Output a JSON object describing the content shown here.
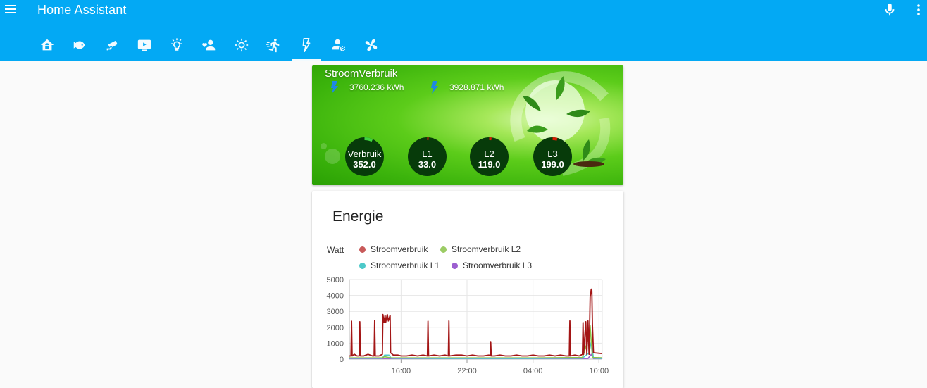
{
  "app": {
    "title": "Home Assistant"
  },
  "tabs": [
    {
      "icon": "home-icon",
      "active": false
    },
    {
      "icon": "fish-icon",
      "active": false
    },
    {
      "icon": "cctv-icon",
      "active": false
    },
    {
      "icon": "television-icon",
      "active": false
    },
    {
      "icon": "lightbulb-icon",
      "active": false
    },
    {
      "icon": "account-heart-icon",
      "active": false
    },
    {
      "icon": "weather-sunny-icon",
      "active": false
    },
    {
      "icon": "run-icon",
      "active": false
    },
    {
      "icon": "flash-icon",
      "active": true
    },
    {
      "icon": "account-settings-icon",
      "active": false
    },
    {
      "icon": "fan-icon",
      "active": false
    }
  ],
  "stroom": {
    "title": "StroomVerbruik",
    "meters": [
      {
        "icon": "flash-icon",
        "value": "3760.236 kWh"
      },
      {
        "icon": "flash-icon",
        "value": "3928.871 kWh"
      }
    ],
    "gauges": [
      {
        "label": "Verbruik",
        "value": "352.0",
        "fraction": 0.07
      },
      {
        "label": "L1",
        "value": "33.0",
        "fraction": 0.01
      },
      {
        "label": "L2",
        "value": "119.0",
        "fraction": 0.02
      },
      {
        "label": "L3",
        "value": "199.0",
        "fraction": 0.04
      }
    ],
    "colors": {
      "gauge_bg": "#073b0a",
      "gauge_arc": "#3fd23f",
      "gauge_arc_low": "#d81e05"
    }
  },
  "energie": {
    "title": "Energie"
  },
  "chart_data": {
    "type": "line",
    "ylabel": "Watt",
    "ylim": [
      0,
      5000
    ],
    "yticks": [
      "0",
      "1000",
      "2000",
      "3000",
      "4000",
      "5000"
    ],
    "xticks": [
      "16:00",
      "22:00",
      "04:00",
      "10:00"
    ],
    "x_ticks_hours": [
      16,
      22,
      28,
      34
    ],
    "xlim_hours": [
      11.3,
      34.3
    ],
    "grid": true,
    "legend_position": "top",
    "series": [
      {
        "name": "Stroomverbruik",
        "color": "#a31515",
        "points": [
          [
            11.3,
            200
          ],
          [
            11.45,
            200
          ],
          [
            11.5,
            2380
          ],
          [
            11.55,
            200
          ],
          [
            11.75,
            300
          ],
          [
            12.0,
            200
          ],
          [
            12.2,
            200
          ],
          [
            12.25,
            2350
          ],
          [
            12.3,
            200
          ],
          [
            12.6,
            200
          ],
          [
            13.0,
            300
          ],
          [
            13.4,
            200
          ],
          [
            13.55,
            200
          ],
          [
            13.6,
            2430
          ],
          [
            13.65,
            200
          ],
          [
            14.0,
            200
          ],
          [
            14.3,
            300
          ],
          [
            14.35,
            2800
          ],
          [
            14.45,
            2300
          ],
          [
            14.55,
            2750
          ],
          [
            14.6,
            2300
          ],
          [
            14.75,
            2800
          ],
          [
            14.85,
            2400
          ],
          [
            15.0,
            2750
          ],
          [
            15.05,
            400
          ],
          [
            15.3,
            250
          ],
          [
            15.7,
            250
          ],
          [
            16.0,
            200
          ],
          [
            16.5,
            200
          ],
          [
            17.0,
            250
          ],
          [
            17.5,
            200
          ],
          [
            18.0,
            250
          ],
          [
            18.4,
            200
          ],
          [
            18.45,
            2380
          ],
          [
            18.5,
            200
          ],
          [
            19.0,
            250
          ],
          [
            19.5,
            200
          ],
          [
            20.0,
            250
          ],
          [
            20.3,
            200
          ],
          [
            20.35,
            2400
          ],
          [
            20.4,
            200
          ],
          [
            21.0,
            250
          ],
          [
            21.5,
            250
          ],
          [
            22.0,
            200
          ],
          [
            22.5,
            250
          ],
          [
            23.0,
            200
          ],
          [
            23.5,
            200
          ],
          [
            24.0,
            250
          ],
          [
            24.1,
            200
          ],
          [
            24.15,
            1100
          ],
          [
            24.2,
            200
          ],
          [
            24.5,
            200
          ],
          [
            25.0,
            250
          ],
          [
            25.5,
            200
          ],
          [
            26.0,
            200
          ],
          [
            26.5,
            250
          ],
          [
            27.0,
            200
          ],
          [
            27.5,
            200
          ],
          [
            28.0,
            250
          ],
          [
            28.5,
            200
          ],
          [
            29.0,
            200
          ],
          [
            29.5,
            250
          ],
          [
            30.0,
            200
          ],
          [
            30.5,
            250
          ],
          [
            31.0,
            200
          ],
          [
            31.3,
            200
          ],
          [
            31.35,
            2400
          ],
          [
            31.4,
            200
          ],
          [
            31.8,
            250
          ],
          [
            32.2,
            200
          ],
          [
            32.5,
            300
          ],
          [
            32.55,
            2300
          ],
          [
            32.6,
            300
          ],
          [
            32.8,
            2350
          ],
          [
            32.9,
            300
          ],
          [
            33.0,
            2400
          ],
          [
            33.1,
            300
          ],
          [
            33.2,
            3900
          ],
          [
            33.3,
            4400
          ],
          [
            33.35,
            4300
          ],
          [
            33.4,
            2200
          ],
          [
            33.5,
            400
          ],
          [
            34.3,
            350
          ]
        ]
      },
      {
        "name": "Stroomverbruik L2",
        "color": "#8bc34a",
        "points": [
          [
            11.3,
            80
          ],
          [
            14.3,
            90
          ],
          [
            14.5,
            150
          ],
          [
            15.0,
            90
          ],
          [
            20.0,
            80
          ],
          [
            28.0,
            80
          ],
          [
            32.5,
            100
          ],
          [
            33.0,
            1200
          ],
          [
            33.2,
            2100
          ],
          [
            33.4,
            100
          ],
          [
            34.3,
            90
          ]
        ]
      },
      {
        "name": "Stroomverbruik L1",
        "color": "#4dc9c9",
        "points": [
          [
            11.3,
            60
          ],
          [
            14.3,
            60
          ],
          [
            14.5,
            250
          ],
          [
            14.9,
            250
          ],
          [
            15.1,
            60
          ],
          [
            20.0,
            50
          ],
          [
            28.0,
            50
          ],
          [
            32.5,
            60
          ],
          [
            33.1,
            400
          ],
          [
            33.3,
            1100
          ],
          [
            33.5,
            60
          ],
          [
            34.3,
            50
          ]
        ]
      },
      {
        "name": "Stroomverbruik L3",
        "color": "#9c5fd0",
        "points": [
          [
            11.3,
            40
          ],
          [
            20.0,
            40
          ],
          [
            28.0,
            40
          ],
          [
            33.0,
            40
          ],
          [
            33.3,
            300
          ],
          [
            33.5,
            40
          ],
          [
            34.3,
            40
          ]
        ]
      }
    ]
  }
}
